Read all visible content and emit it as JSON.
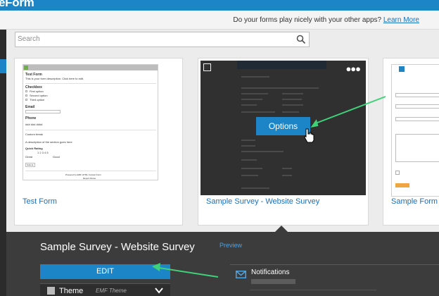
{
  "brand": {
    "logo_text": "eForm"
  },
  "promo": {
    "question": "Do your forms play nicely with your other apps?",
    "link": "Learn More"
  },
  "search": {
    "placeholder": "Search"
  },
  "cards": [
    {
      "name": "Test Form"
    },
    {
      "name": "Sample Survey - Website Survey",
      "options_label": "Options",
      "more_icon": "more-dots-icon"
    },
    {
      "name": "Sample Form -"
    }
  ],
  "test_form_preview": {
    "title": "Test Form",
    "description": "This is your form description. Click here to edit.",
    "checkbox_label": "Checkbox",
    "options": [
      "First option",
      "Second option",
      "Third option"
    ],
    "email_label": "Email",
    "phone_label": "Phone",
    "phone_mask": "###  ###  ####",
    "custom_break": "Custom break",
    "section_desc": "A description of the section goes here",
    "rating_label": "Quick Rating",
    "rating_numbers": "1  2  3  4  5",
    "rating_low": "Great",
    "rating_high": "Good",
    "submit": "Submit",
    "footer": "Powered by  EMF HTML Contact Form",
    "footer2": "Report Abuse"
  },
  "detail": {
    "title": "Sample Survey - Website Survey",
    "preview_link": "Preview",
    "edit_label": "EDIT",
    "theme_label": "Theme",
    "theme_name": "EMF Theme",
    "notifications_label": "Notifications"
  },
  "colors": {
    "brand_blue": "#1b85c7",
    "link_blue": "#1b6fb5",
    "annotation_green": "#3fd17a",
    "dark_panel": "#3c3c3c"
  }
}
